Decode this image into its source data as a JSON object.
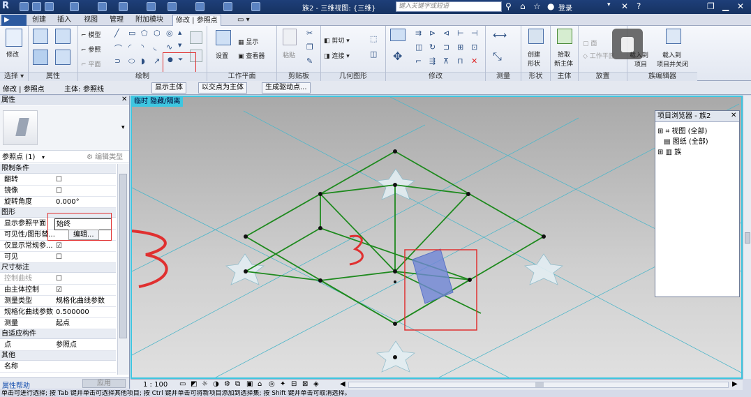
{
  "titlebar": {
    "app_letter": "R",
    "doc_title": "族2 - 三维视图: {三维}",
    "search_placeholder": "键入关键字或短语",
    "login": "登录"
  },
  "tabs": [
    "创建",
    "插入",
    "视图",
    "管理",
    "附加模块",
    "修改 | 参照点"
  ],
  "ribbon": {
    "select": {
      "modify": "修改",
      "label": "选择 ▾"
    },
    "properties": {
      "label": "属性"
    },
    "draw": {
      "model": "模型",
      "reference": "参照",
      "plane": "平面",
      "label": "绘制"
    },
    "workplane": {
      "set": "设置",
      "show": "显示",
      "viewer": "查看器",
      "label": "工作平面"
    },
    "clipboard": {
      "paste": "粘贴",
      "label": "剪贴板"
    },
    "geometry": {
      "cut": "剪切",
      "join": "连接",
      "label": "几何图形"
    },
    "modify": {
      "label": "修改"
    },
    "measure": {
      "label": "测量"
    },
    "form": {
      "create": "创建",
      "form": "形状",
      "label": "形状"
    },
    "host": {
      "pick": "拾取",
      "new_host": "新主体",
      "label": "主体"
    },
    "place": {
      "face": "面",
      "workplane": "工作平面",
      "label": "放置"
    },
    "family_editor": {
      "load_to_project": "载入到",
      "project": "项目",
      "load_close": "载入到",
      "project_close": "项目并关闭",
      "label": "族编辑器"
    }
  },
  "optionsbar": {
    "context": "修改 | 参照点",
    "host_label": "主体:",
    "host_value": "参照线",
    "show_host": "显示主体",
    "host_by_intersect": "以交点为主体",
    "generate_points": "生成驱动点..."
  },
  "properties": {
    "title": "属性",
    "type_selector": "参照点 (1)",
    "edit_type": "编辑类型",
    "groups": [
      {
        "name": "限制条件",
        "rows": [
          {
            "k": "翻转",
            "v": "☐"
          },
          {
            "k": "镜像",
            "v": "☐"
          },
          {
            "k": "旋转角度",
            "v": "0.000°"
          }
        ]
      },
      {
        "name": "图形",
        "rows": [
          {
            "k": "显示参照平面",
            "v": "始终"
          },
          {
            "k": "可见性/图形替...",
            "v": "编辑..."
          },
          {
            "k": "仅显示常规参...",
            "v": "☑"
          },
          {
            "k": "可见",
            "v": "☐"
          }
        ]
      },
      {
        "name": "尺寸标注",
        "rows": [
          {
            "k": "控制曲线",
            "v": "☐"
          },
          {
            "k": "由主体控制",
            "v": "☑"
          },
          {
            "k": "测量类型",
            "v": "规格化曲线参数"
          },
          {
            "k": "规格化曲线参数",
            "v": "0.500000"
          },
          {
            "k": "测量",
            "v": "起点"
          }
        ]
      },
      {
        "name": "自适应构件",
        "rows": [
          {
            "k": "点",
            "v": "参照点"
          }
        ]
      },
      {
        "name": "其他",
        "rows": [
          {
            "k": "名称",
            "v": ""
          }
        ]
      }
    ],
    "help": "属性帮助",
    "apply": "应用"
  },
  "viewport": {
    "label": "临时 隐藏/隔离"
  },
  "browser": {
    "title": "项目浏览器 - 族2",
    "items": [
      "视图 (全部)",
      "图纸 (全部)",
      "族"
    ]
  },
  "viewbar": {
    "scale": "1 : 100"
  },
  "statusbar": {
    "text": "单击可进行选择; 按 Tab 键并单击可选择其他项目; 按 Ctrl 键并单击可将新项目添加到选择集; 按 Shift 键并单击可取消选择。"
  },
  "colors": {
    "accent": "#3ec6e0",
    "frame": "#1e3f79",
    "model_line": "#1f8a1f",
    "annotation": "#e03030"
  }
}
